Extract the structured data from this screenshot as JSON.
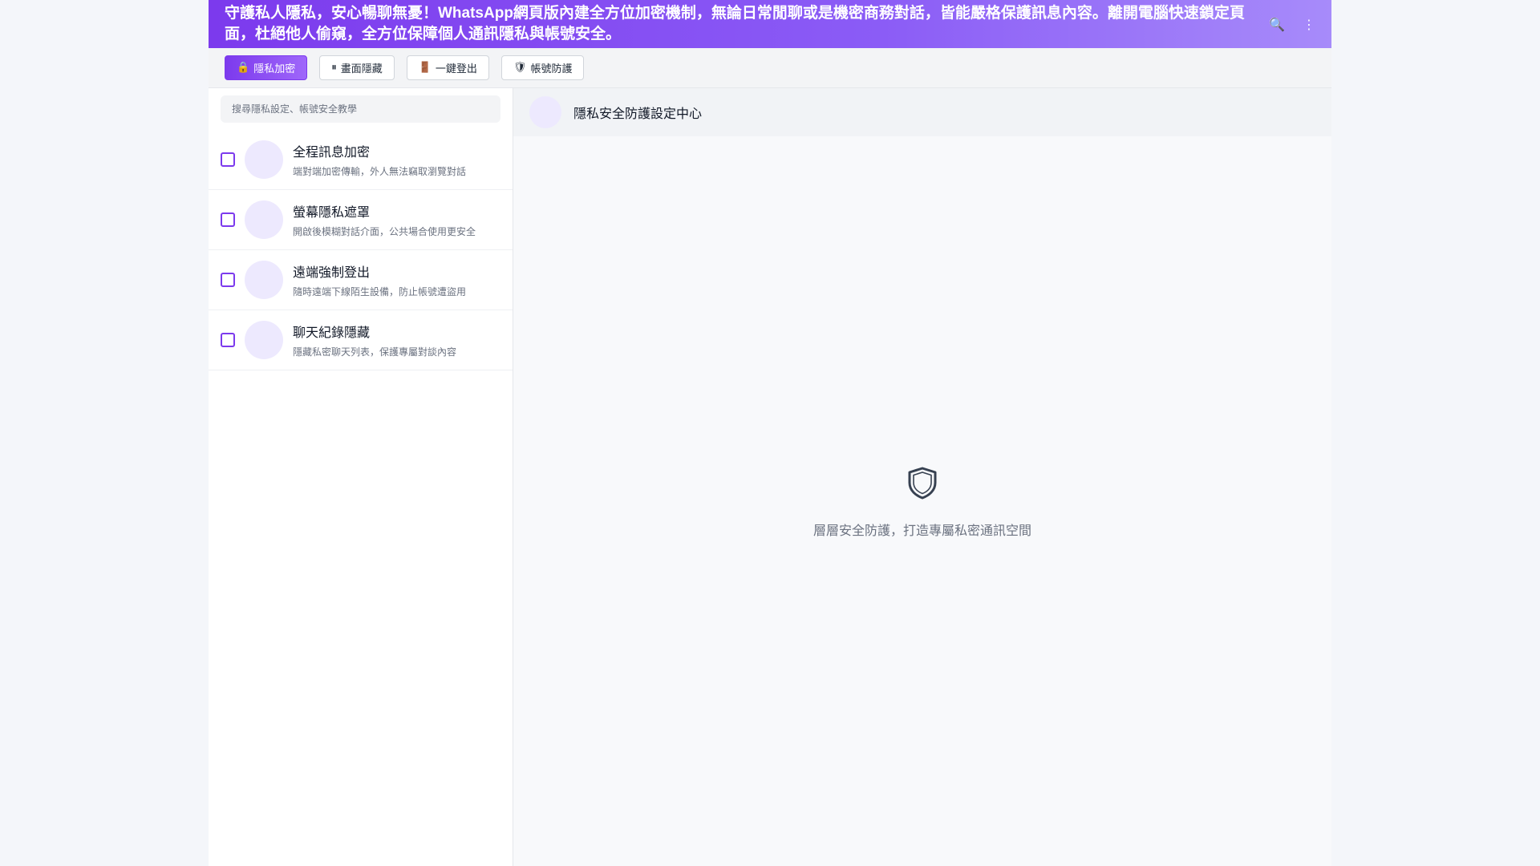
{
  "banner": {
    "text": "守護私人隱私，安心暢聊無憂！WhatsApp網頁版內建全方位加密機制，無論日常閒聊或是機密商務對話，皆能嚴格保護訊息內容。離開電腦快速鎖定頁面，杜絕他人偷窺，全方位保障個人通訊隱私與帳號安全。",
    "search_icon": "🔍",
    "menu_icon": "⋮"
  },
  "toolbar": {
    "buttons": [
      {
        "icon": "🔒",
        "label": "隱私加密"
      },
      {
        "icon": "⏸",
        "label": "畫面隱藏"
      },
      {
        "icon": "🚪",
        "label": "一鍵登出"
      },
      {
        "icon": "🛡",
        "label": "帳號防護"
      }
    ]
  },
  "sidebar": {
    "search_placeholder": "搜尋隱私設定、帳號安全教學",
    "items": [
      {
        "title": "全程訊息加密",
        "subtitle": "端對端加密傳輸，外人無法竊取瀏覽對話"
      },
      {
        "title": "螢幕隱私遮罩",
        "subtitle": "開啟後模糊對話介面，公共場合使用更安全"
      },
      {
        "title": "遠端強制登出",
        "subtitle": "隨時遠端下線陌生設備，防止帳號遭盜用"
      },
      {
        "title": "聊天紀錄隱藏",
        "subtitle": "隱藏私密聊天列表，保護專屬對談內容"
      }
    ]
  },
  "main": {
    "header_title": "隱私安全防護設定中心",
    "empty_text": "層層安全防護，打造專屬私密通訊空間"
  },
  "colors": {
    "accent": "#7c3aed",
    "avatar_bg": "#ede9fe"
  }
}
